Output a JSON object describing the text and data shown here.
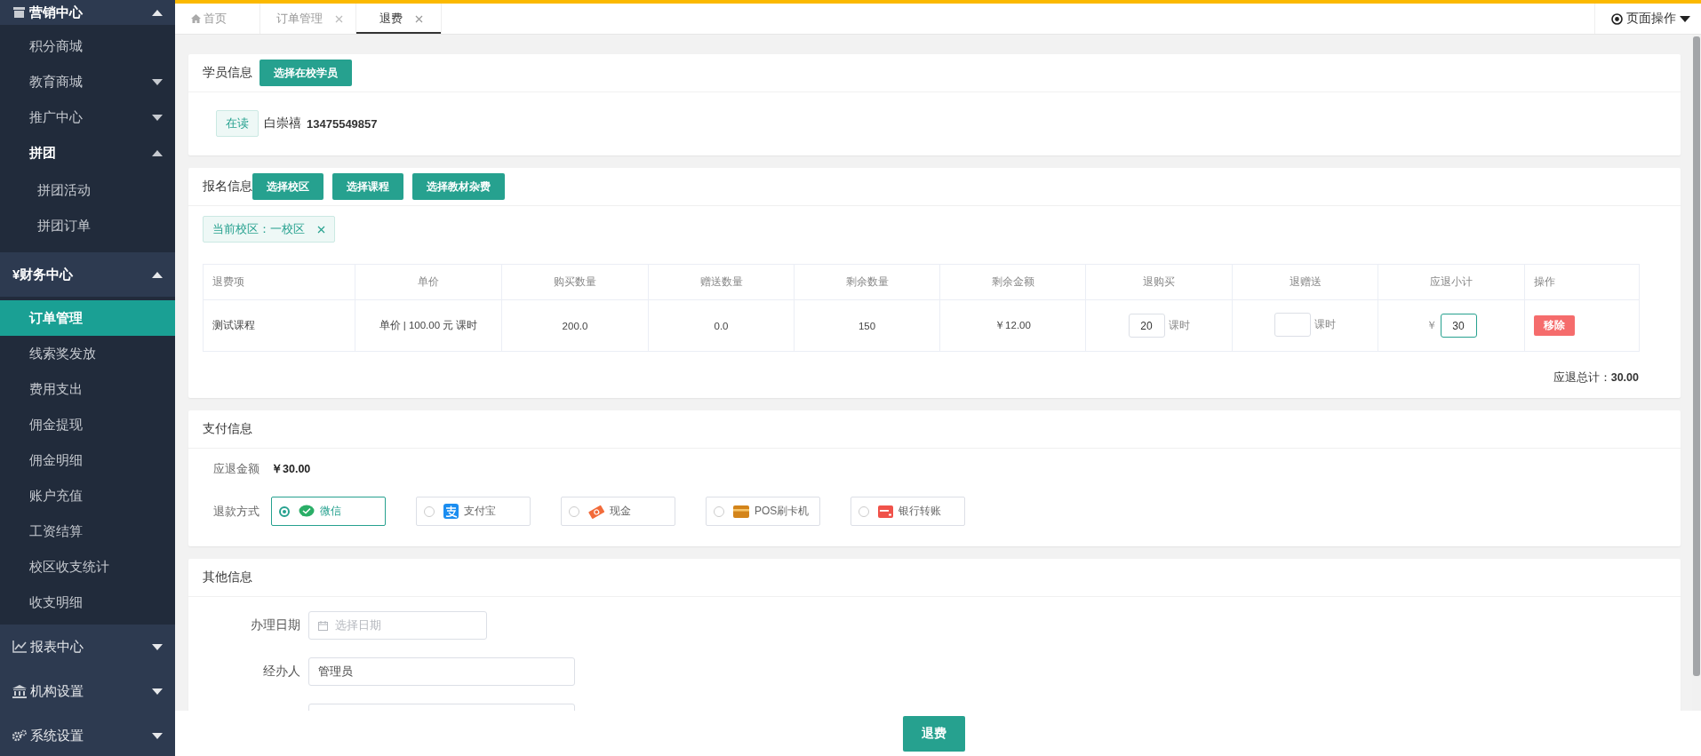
{
  "sidebar": {
    "items": [
      {
        "label": "营销中心",
        "expanded": true,
        "selected": false,
        "children": [
          {
            "label": "积分商城",
            "selected": false
          },
          {
            "label": "教育商城",
            "expanded": false,
            "selected": false
          },
          {
            "label": "推广中心",
            "expanded": false,
            "selected": false
          },
          {
            "label": "拼团",
            "expanded": true,
            "selected": false,
            "children": [
              {
                "label": "拼团活动",
                "selected": false
              },
              {
                "label": "拼团订单",
                "selected": false
              }
            ]
          }
        ]
      },
      {
        "label": "¥财务中心",
        "expanded": true,
        "selected": false,
        "children": [
          {
            "label": "订单管理",
            "selected": true
          },
          {
            "label": "线索奖发放",
            "selected": false
          },
          {
            "label": "费用支出",
            "selected": false
          },
          {
            "label": "佣金提现",
            "selected": false
          },
          {
            "label": "佣金明细",
            "selected": false
          },
          {
            "label": "账户充值",
            "selected": false
          },
          {
            "label": "工资结算",
            "selected": false
          },
          {
            "label": "校区收支统计",
            "selected": false
          },
          {
            "label": "收支明细",
            "selected": false
          }
        ]
      },
      {
        "label": "报表中心",
        "expanded": false,
        "selected": false
      },
      {
        "label": "机构设置",
        "expanded": false,
        "selected": false
      },
      {
        "label": "系统设置",
        "expanded": false,
        "selected": false
      }
    ]
  },
  "tabs": [
    {
      "label": "首页",
      "kind": "home",
      "closable": false,
      "selected": false
    },
    {
      "label": "订单管理",
      "kind": "page",
      "closable": true,
      "selected": false
    },
    {
      "label": "退费",
      "kind": "page",
      "closable": true,
      "selected": true
    }
  ],
  "page_actions": "页面操作",
  "student_info": {
    "title": "学员信息",
    "button": "选择在校学员",
    "status": "在读",
    "name": "白崇禧",
    "phone": "13475549857"
  },
  "enrollment_info": {
    "title": "报名信息",
    "buttons": [
      "选择校区",
      "选择课程",
      "选择教材杂费"
    ],
    "campus_tag": "当前校区：一校区",
    "table": {
      "columns": [
        "退费项",
        "单价",
        "购买数量",
        "赠送数量",
        "剩余数量",
        "剩余金额",
        "退购买",
        "退赠送",
        "应退小计",
        "操作"
      ],
      "rows": [
        {
          "cells": [
            {
              "kind": "text",
              "text": "测试课程"
            },
            {
              "kind": "text",
              "text": "单价 | 100.00 元 课时"
            },
            {
              "kind": "text",
              "text": "200.0"
            },
            {
              "kind": "text",
              "text": "0.0"
            },
            {
              "kind": "text",
              "text": "150"
            },
            {
              "kind": "text",
              "text": "￥12.00"
            },
            {
              "kind": "input",
              "value": "20",
              "suffix": "课时",
              "focused": false
            },
            {
              "kind": "input",
              "suffix": "课时",
              "focused": false
            },
            {
              "kind": "input",
              "prefix": "￥",
              "value": "30",
              "focused": true
            },
            {
              "kind": "button",
              "text": "移除"
            }
          ]
        }
      ]
    },
    "total_label": "应退总计：",
    "total_value": "30.00"
  },
  "payment_info": {
    "title": "支付信息",
    "amount_label": "应退金额",
    "amount_value": "￥30.00",
    "method_label": "退款方式",
    "methods": [
      {
        "label": "微信",
        "kind": "wechat",
        "selected": true
      },
      {
        "label": "支付宝",
        "kind": "alipay",
        "selected": false
      },
      {
        "label": "现金",
        "kind": "cash",
        "selected": false
      },
      {
        "label": "POS刷卡机",
        "kind": "pos",
        "selected": false
      },
      {
        "label": "银行转账",
        "kind": "bank",
        "selected": false
      }
    ]
  },
  "other_info": {
    "title": "其他信息",
    "fields": [
      {
        "label": "办理日期",
        "kind": "date",
        "placeholder": "选择日期"
      },
      {
        "label": "经办人",
        "kind": "text",
        "value": "管理员"
      },
      {
        "kind": "text"
      }
    ]
  },
  "footer": {
    "button": "退费"
  }
}
